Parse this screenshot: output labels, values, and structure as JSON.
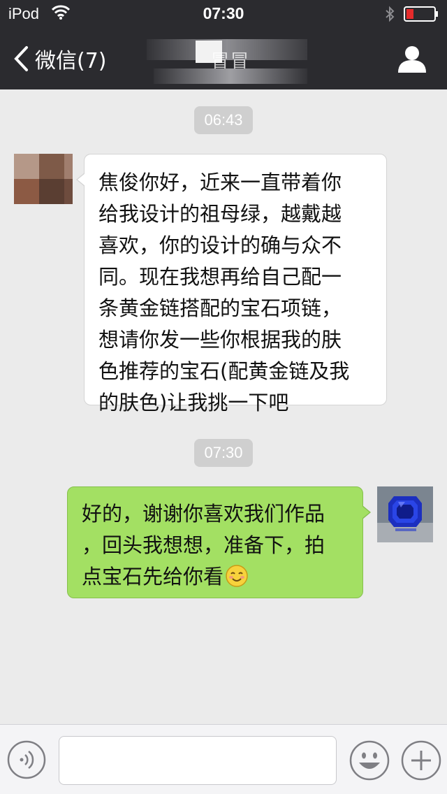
{
  "status_bar": {
    "device": "iPod",
    "time": "07:30",
    "icons": [
      "wifi-icon",
      "bluetooth-icon",
      "battery-icon"
    ],
    "battery_color": "#e52b2b"
  },
  "nav": {
    "back_label": "微信(7)",
    "title": "冒冒",
    "icons": [
      "chevron-left-icon",
      "profile-icon"
    ]
  },
  "chat": {
    "messages": [
      {
        "type": "timestamp",
        "text": "06:43"
      },
      {
        "type": "incoming",
        "lines": [
          "焦俊你好，近来一直带着你",
          "给我设计的祖母绿，越戴越",
          "喜欢，你的设计的确与众不",
          "同。现在我想再给自己配一",
          "条黄金链搭配的宝石项链，",
          "想请你发一些你根据我的肤",
          "色推荐的宝石(配黄金链及我",
          "的肤色)让我挑一下吧"
        ]
      },
      {
        "type": "timestamp",
        "text": "07:30"
      },
      {
        "type": "outgoing",
        "lines": [
          "好的，谢谢你喜欢我们作品",
          "，回头我想想，准备下，拍",
          "点宝石先给你看"
        ],
        "trailing_emoji": "smile-emoji-icon"
      }
    ]
  },
  "input_bar": {
    "icons": [
      "voice-icon",
      "emoji-icon",
      "plus-icon"
    ],
    "text_value": ""
  },
  "colors": {
    "bar_background": "#2b2b2f",
    "chat_background": "#ebebeb",
    "outgoing_bubble": "#a3e063",
    "incoming_bubble": "#ffffff",
    "timestamp_bg": "#cfcfcf"
  }
}
